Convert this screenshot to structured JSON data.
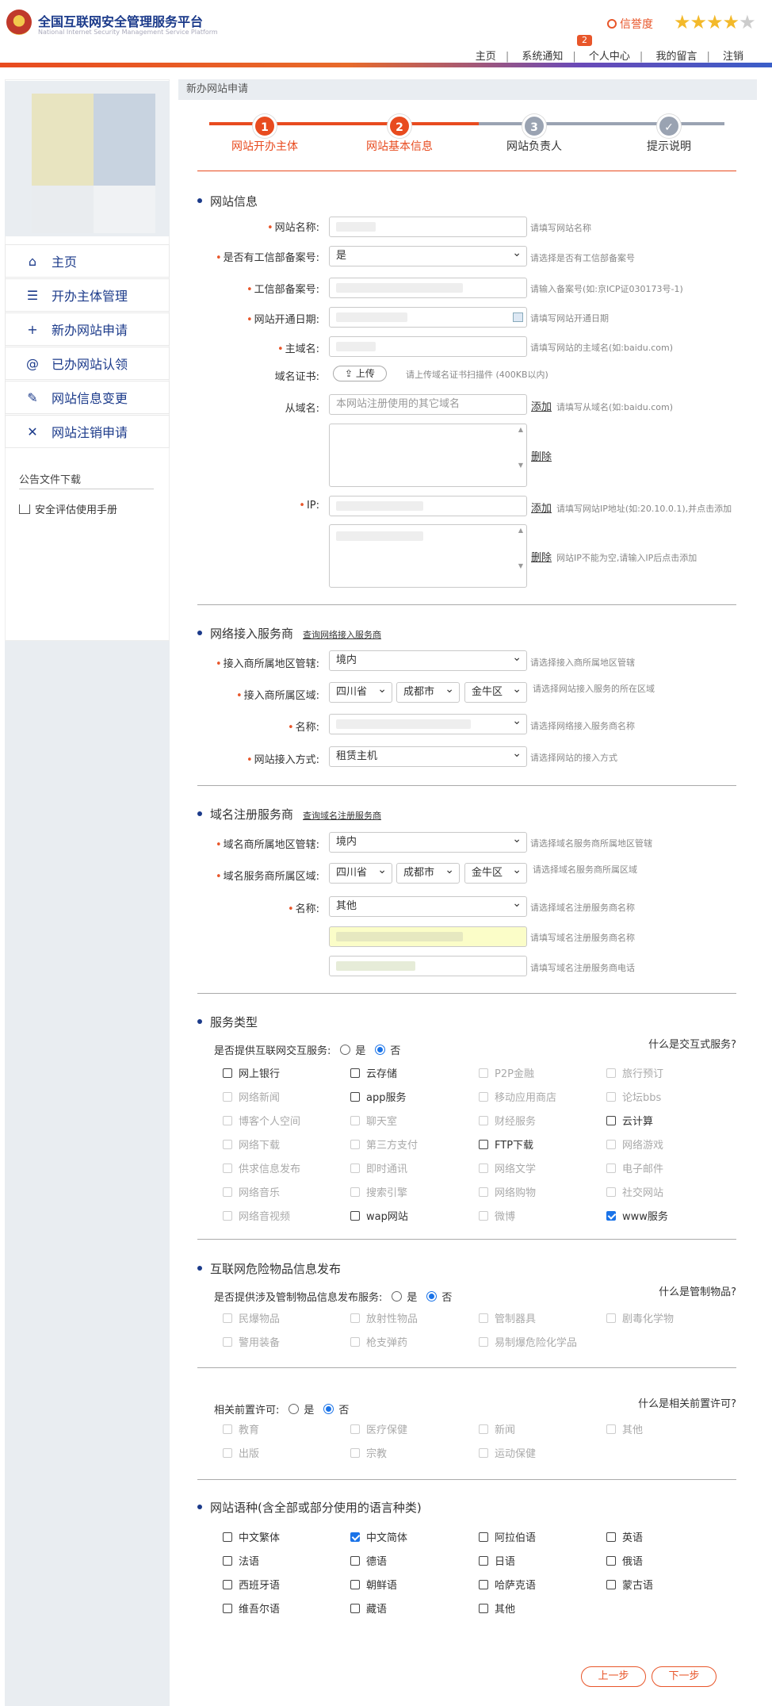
{
  "header": {
    "title": "全国互联网安全管理服务平台",
    "subtitle": "National Internet Security Management Service Platform",
    "credit_label": "信誉度",
    "rating": 4,
    "rating_max": 5,
    "notice_badge": "2",
    "nav": [
      "主页",
      "系统通知",
      "个人中心",
      "我的留言",
      "注销"
    ]
  },
  "sidebar": {
    "menu": [
      {
        "label": "主页",
        "icon": "home-icon",
        "glyph": "⌂"
      },
      {
        "label": "开办主体管理",
        "icon": "list-icon",
        "glyph": "☰"
      },
      {
        "label": "新办网站申请",
        "icon": "plus-icon",
        "glyph": "+"
      },
      {
        "label": "已办网站认领",
        "icon": "at-icon",
        "glyph": "@"
      },
      {
        "label": "网站信息变更",
        "icon": "edit-icon",
        "glyph": "✎"
      },
      {
        "label": "网站注销申请",
        "icon": "close-icon",
        "glyph": "✕"
      }
    ],
    "notice_title": "公告文件下载",
    "download": "安全评估使用手册"
  },
  "breadcrumb": "新办网站申请",
  "steps": [
    {
      "num": "1",
      "label": "网站开办主体",
      "state": "done"
    },
    {
      "num": "2",
      "label": "网站基本信息",
      "state": "current"
    },
    {
      "num": "3",
      "label": "网站负责人",
      "state": "todo"
    },
    {
      "num": "✓",
      "label": "提示说明",
      "state": "todo"
    }
  ],
  "website_info": {
    "title": "网站信息",
    "name": {
      "label": "网站名称:",
      "hint": "请填写网站名称"
    },
    "icp_flag": {
      "label": "是否有工信部备案号:",
      "value": "是",
      "hint": "请选择是否有工信部备案号"
    },
    "icp": {
      "label": "工信部备案号:",
      "hint": "请输入备案号(如:京ICP证030173号-1)"
    },
    "open_date": {
      "label": "网站开通日期:",
      "hint": "请填写网站开通日期"
    },
    "domain": {
      "label": "主域名:",
      "hint": "请填写网站的主域名(如:baidu.com)"
    },
    "cert": {
      "label": "域名证书:",
      "button": "上传",
      "hint": "请上传域名证书扫描件 (400KB以内)"
    },
    "sub_domain": {
      "label": "从域名:",
      "placeholder": "本网站注册使用的其它域名",
      "add": "添加",
      "hint": "请填写从域名(如:baidu.com)",
      "delete": "删除"
    },
    "ip": {
      "label": "IP:",
      "add": "添加",
      "hint": "请填写网站IP地址(如:20.10.0.1),并点击添加",
      "delete": "删除",
      "delete_hint": "网站IP不能为空,请输入IP后点击添加"
    }
  },
  "access_provider": {
    "title": "网络接入服务商",
    "link": "查询网络接入服务商",
    "region": {
      "label": "接入商所属地区管辖:",
      "value": "境内",
      "hint": "请选择接入商所属地区管辖"
    },
    "area": {
      "label": "接入商所属区域:",
      "province": "四川省",
      "city": "成都市",
      "district": "金牛区",
      "hint": "请选择网站接入服务的所在区域"
    },
    "name": {
      "label": "名称:",
      "hint": "请选择网络接入服务商名称"
    },
    "mode": {
      "label": "网站接入方式:",
      "value": "租赁主机",
      "hint": "请选择网站的接入方式"
    }
  },
  "registrar": {
    "title": "域名注册服务商",
    "link": "查询域名注册服务商",
    "region": {
      "label": "域名商所属地区管辖:",
      "value": "境内",
      "hint": "请选择域名服务商所属地区管辖"
    },
    "area": {
      "label": "域名服务商所属区域:",
      "province": "四川省",
      "city": "成都市",
      "district": "金牛区",
      "hint": "请选择域名服务商所属区域"
    },
    "name": {
      "label": "名称:",
      "value": "其他",
      "hint": "请选择域名注册服务商名称"
    },
    "name_input_hint": "请填写域名注册服务商名称",
    "phone_hint": "请填写域名注册服务商电话"
  },
  "service_type": {
    "title": "服务类型",
    "question": "是否提供互联网交互服务:",
    "yes": "是",
    "no": "否",
    "selected": "否",
    "help": "什么是交互式服务?",
    "items": [
      {
        "label": "网上银行",
        "enabled": true,
        "checked": false
      },
      {
        "label": "云存储",
        "enabled": true,
        "checked": false
      },
      {
        "label": "P2P金融",
        "enabled": false,
        "checked": false
      },
      {
        "label": "旅行预订",
        "enabled": false,
        "checked": false
      },
      {
        "label": "网络新闻",
        "enabled": false,
        "checked": false
      },
      {
        "label": "app服务",
        "enabled": true,
        "checked": false
      },
      {
        "label": "移动应用商店",
        "enabled": false,
        "checked": false
      },
      {
        "label": "论坛bbs",
        "enabled": false,
        "checked": false
      },
      {
        "label": "博客个人空间",
        "enabled": false,
        "checked": false
      },
      {
        "label": "聊天室",
        "enabled": false,
        "checked": false
      },
      {
        "label": "财经服务",
        "enabled": false,
        "checked": false
      },
      {
        "label": "云计算",
        "enabled": true,
        "checked": false
      },
      {
        "label": "网络下载",
        "enabled": false,
        "checked": false
      },
      {
        "label": "第三方支付",
        "enabled": false,
        "checked": false
      },
      {
        "label": "FTP下载",
        "enabled": true,
        "checked": false
      },
      {
        "label": "网络游戏",
        "enabled": false,
        "checked": false
      },
      {
        "label": "供求信息发布",
        "enabled": false,
        "checked": false
      },
      {
        "label": "即时通讯",
        "enabled": false,
        "checked": false
      },
      {
        "label": "网络文学",
        "enabled": false,
        "checked": false
      },
      {
        "label": "电子邮件",
        "enabled": false,
        "checked": false
      },
      {
        "label": "网络音乐",
        "enabled": false,
        "checked": false
      },
      {
        "label": "搜索引擎",
        "enabled": false,
        "checked": false
      },
      {
        "label": "网络购物",
        "enabled": false,
        "checked": false
      },
      {
        "label": "社交网站",
        "enabled": false,
        "checked": false
      },
      {
        "label": "网络音视频",
        "enabled": false,
        "checked": false
      },
      {
        "label": "wap网站",
        "enabled": true,
        "checked": false
      },
      {
        "label": "微博",
        "enabled": false,
        "checked": false
      },
      {
        "label": "www服务",
        "enabled": true,
        "checked": true
      }
    ]
  },
  "dangerous": {
    "title": "互联网危险物品信息发布",
    "question": "是否提供涉及管制物品信息发布服务:",
    "yes": "是",
    "no": "否",
    "selected": "否",
    "help": "什么是管制物品?",
    "items": [
      "民爆物品",
      "放射性物品",
      "管制器具",
      "剧毒化学物",
      "警用装备",
      "枪支弹药",
      "易制爆危险化学品"
    ]
  },
  "prelicense": {
    "question": "相关前置许可:",
    "yes": "是",
    "no": "否",
    "selected": "否",
    "help": "什么是相关前置许可?",
    "items": [
      "教育",
      "医疗保健",
      "新闻",
      "其他",
      "出版",
      "宗教",
      "运动保健"
    ]
  },
  "language": {
    "title": "网站语种(含全部或部分使用的语言种类)",
    "items": [
      {
        "label": "中文繁体",
        "checked": false
      },
      {
        "label": "中文简体",
        "checked": true
      },
      {
        "label": "阿拉伯语",
        "checked": false
      },
      {
        "label": "英语",
        "checked": false
      },
      {
        "label": "法语",
        "checked": false
      },
      {
        "label": "德语",
        "checked": false
      },
      {
        "label": "日语",
        "checked": false
      },
      {
        "label": "俄语",
        "checked": false
      },
      {
        "label": "西班牙语",
        "checked": false
      },
      {
        "label": "朝鲜语",
        "checked": false
      },
      {
        "label": "哈萨克语",
        "checked": false
      },
      {
        "label": "蒙古语",
        "checked": false
      },
      {
        "label": "维吾尔语",
        "checked": false
      },
      {
        "label": "藏语",
        "checked": false
      },
      {
        "label": "其他",
        "checked": false
      }
    ]
  },
  "buttons": {
    "prev": "上一步",
    "next": "下一步"
  },
  "colors": {
    "accent": "#e8562a",
    "brand": "#1b3a8a",
    "check": "#1a73e8"
  }
}
